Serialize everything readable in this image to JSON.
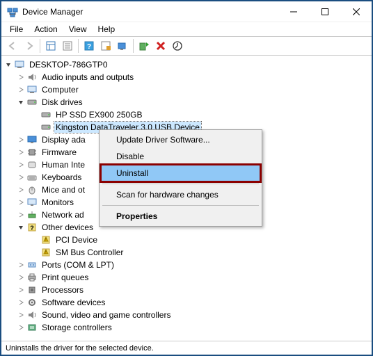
{
  "window": {
    "title": "Device Manager"
  },
  "menu": {
    "file": "File",
    "action": "Action",
    "view": "View",
    "help": "Help"
  },
  "tree": {
    "root": "DESKTOP-786GTP0",
    "audio": "Audio inputs and outputs",
    "computer": "Computer",
    "disk": "Disk drives",
    "disk_hp": "HP SSD EX900 250GB",
    "disk_kingston": "Kingston DataTraveler 3.0 USB Device",
    "display": "Display ada",
    "firmware": "Firmware",
    "hid": "Human Inte",
    "keyboards": "Keyboards",
    "mice": "Mice and ot",
    "monitors": "Monitors",
    "network": "Network ad",
    "other": "Other devices",
    "pci": "PCI Device",
    "sm": "SM Bus Controller",
    "ports": "Ports (COM & LPT)",
    "print": "Print queues",
    "processors": "Processors",
    "software": "Software devices",
    "sound": "Sound, video and game controllers",
    "storage": "Storage controllers"
  },
  "context_menu": {
    "update": "Update Driver Software...",
    "disable": "Disable",
    "uninstall": "Uninstall",
    "scan": "Scan for hardware changes",
    "properties": "Properties"
  },
  "status": "Uninstalls the driver for the selected device."
}
